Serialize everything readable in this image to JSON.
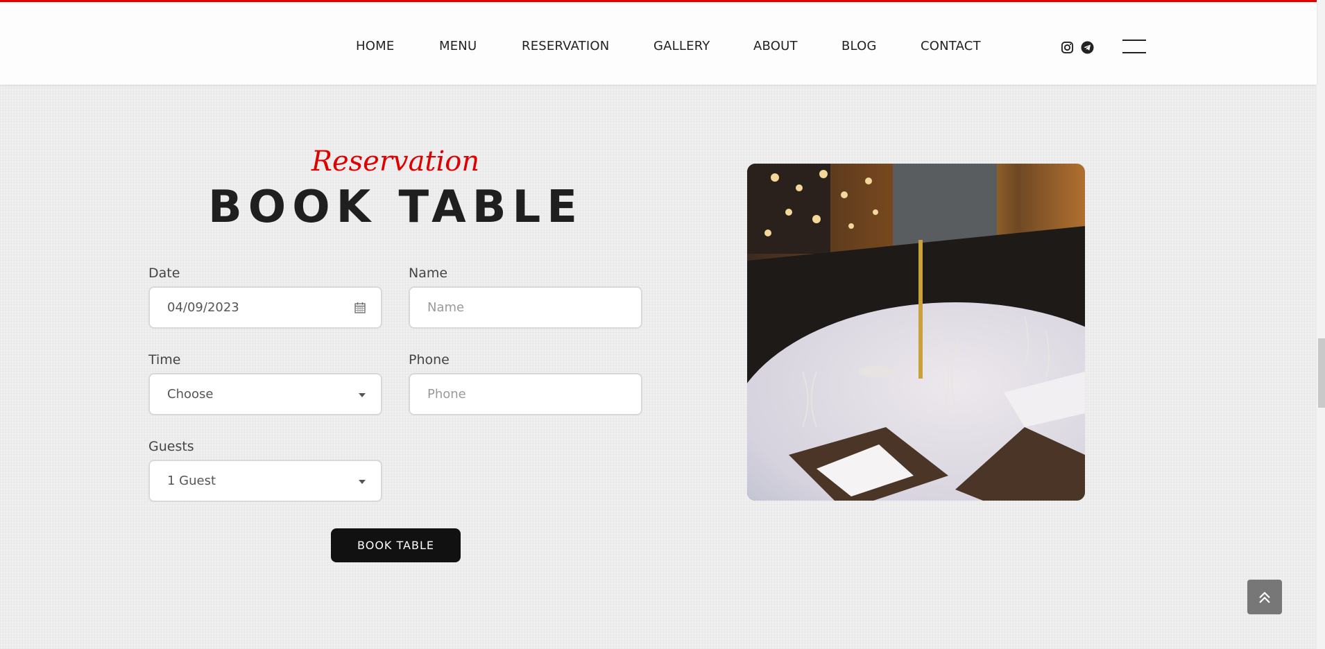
{
  "nav": {
    "items": [
      "HOME",
      "MENU",
      "RESERVATION",
      "GALLERY",
      "ABOUT",
      "BLOG",
      "CONTACT"
    ]
  },
  "social": {
    "icons": [
      "instagram-icon",
      "telegram-icon"
    ]
  },
  "section": {
    "eyebrow": "Reservation",
    "title": "BOOK TABLE"
  },
  "form": {
    "date": {
      "label": "Date",
      "value": "04/09/2023"
    },
    "name": {
      "label": "Name",
      "placeholder": "Name"
    },
    "time": {
      "label": "Time",
      "value": "Choose"
    },
    "phone": {
      "label": "Phone",
      "placeholder": "Phone"
    },
    "guests": {
      "label": "Guests",
      "value": "1 Guest"
    },
    "submit_label": "BOOK TABLE"
  },
  "colors": {
    "accent": "#e60000",
    "button": "#111111",
    "background": "#efefef"
  }
}
